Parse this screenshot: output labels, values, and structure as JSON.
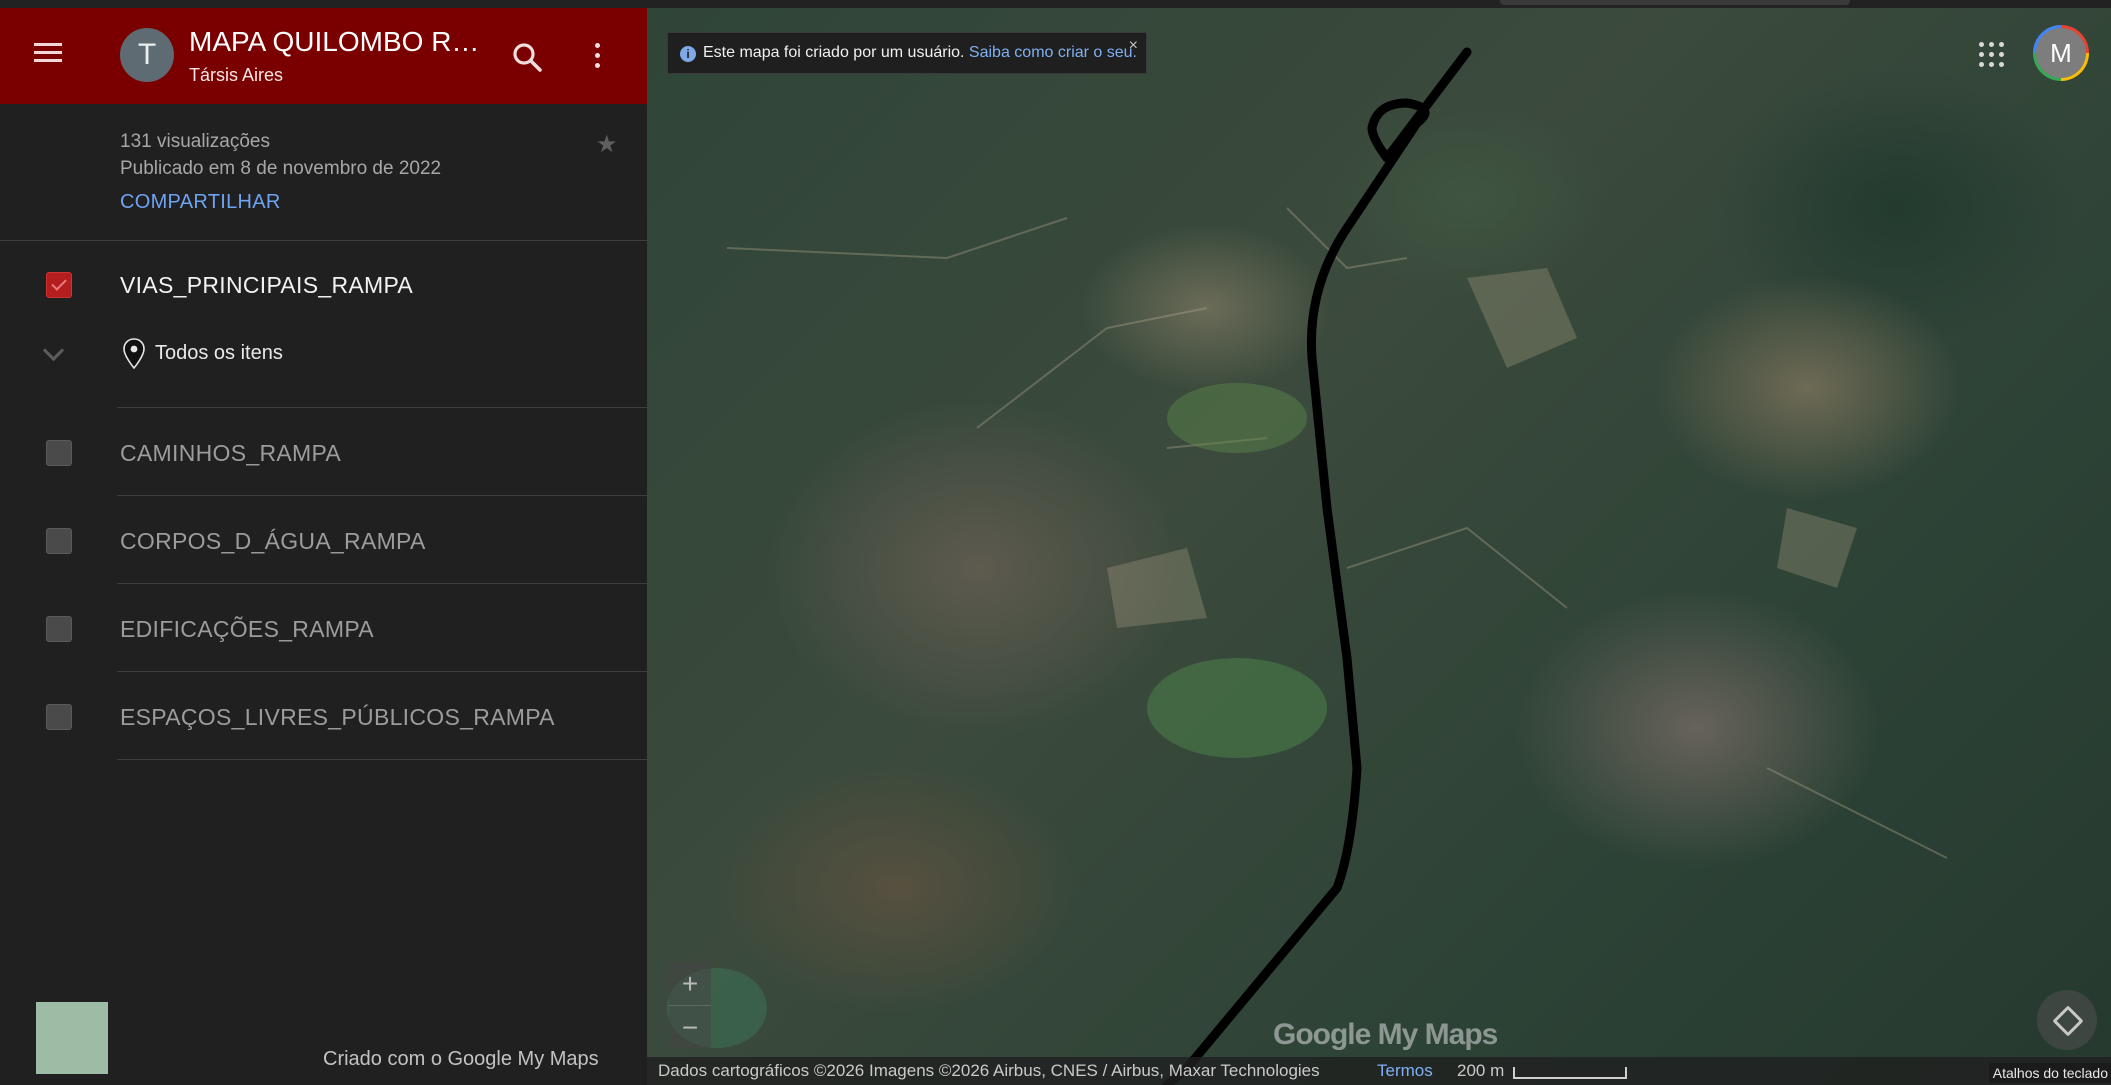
{
  "header": {
    "avatar_letter": "T",
    "title": "MAPA QUILOMBO RAMPA",
    "author": "Társis Aires"
  },
  "meta": {
    "views": "131 visualizações",
    "published": "Publicado em 8 de novembro de 2022",
    "share": "COMPARTILHAR"
  },
  "layers": [
    {
      "name": "VIAS_PRINCIPAIS_RAMPA",
      "checked": true
    },
    {
      "name": "CAMINHOS_RAMPA",
      "checked": false
    },
    {
      "name": "CORPOS_D_ÁGUA_RAMPA",
      "checked": false
    },
    {
      "name": "EDIFICAÇÕES_RAMPA",
      "checked": false
    },
    {
      "name": "ESPAÇOS_LIVRES_PÚBLICOS_RAMPA",
      "checked": false
    }
  ],
  "layer_items": {
    "all": "Todos os itens"
  },
  "footer": {
    "credit": "Criado com o Google My Maps"
  },
  "map": {
    "banner_text": "Este mapa foi criado por um usuário.",
    "banner_link": "Saiba como criar o seu.",
    "close": "×",
    "account_letter": "M",
    "zoom_in": "+",
    "zoom_out": "−",
    "logo": "Google My Maps",
    "attribution": "Dados cartográficos ©2026 Imagens ©2026 Airbus, CNES / Airbus, Maxar Technologies",
    "terms": "Termos",
    "scale": "200 m",
    "shortcuts": "Atalhos do teclado"
  },
  "colors": {
    "header_bg": "#7a0000",
    "sidebar_bg": "#202020",
    "link_blue": "#6ea3f2",
    "checkbox_on": "#b41e1e"
  }
}
